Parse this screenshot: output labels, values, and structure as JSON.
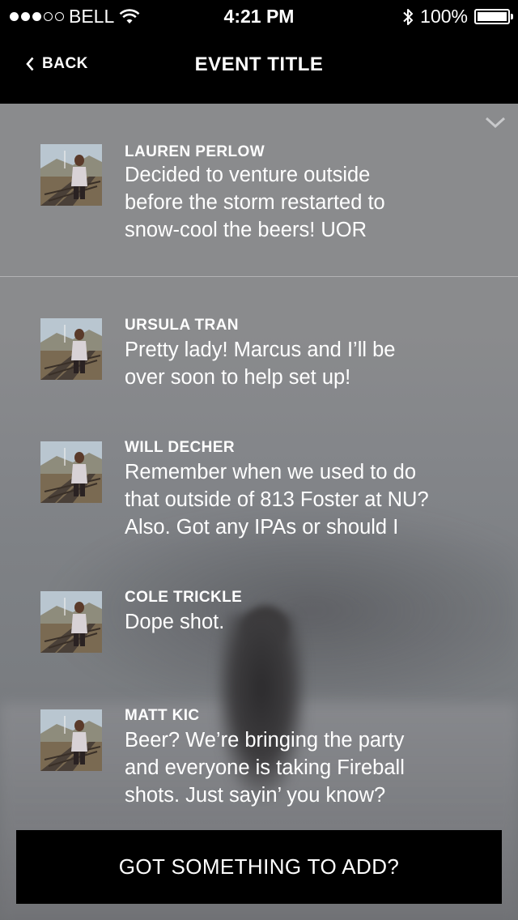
{
  "status_bar": {
    "carrier": "BELL",
    "signal_filled": 3,
    "signal_total": 5,
    "time": "4:21 PM",
    "battery_percent_label": "100%",
    "battery_level": 1.0
  },
  "nav": {
    "back_label": "BACK",
    "title": "EVENT TITLE"
  },
  "comments": [
    {
      "author": "LAUREN PERLOW",
      "line1": "Decided to venture outside",
      "line2": "before the storm restarted to",
      "line3": "snow-cool the beers! UOR"
    },
    {
      "author": "URSULA TRAN",
      "line1": "Pretty lady! Marcus and I’ll be",
      "line2": "over soon to help set up!"
    },
    {
      "author": "WILL DECHER",
      "line1": "Remember when we used to do",
      "line2": "that outside of 813 Foster at NU?",
      "line3": "Also. Got any IPAs or should I"
    },
    {
      "author": "COLE TRICKLE",
      "line1": "Dope shot."
    },
    {
      "author": "MATT KIC",
      "line1": "Beer? We’re bringing the party",
      "line2": "and everyone is taking Fireball",
      "line3": "shots. Just sayin’ you know?"
    }
  ],
  "add_button_label": "GOT SOMETHING TO ADD?",
  "icons": {
    "back": "chevron-left-icon",
    "collapse": "chevron-down-icon",
    "wifi": "wifi-icon",
    "bluetooth": "bluetooth-icon",
    "battery": "battery-icon"
  },
  "colors": {
    "bars": "#000000",
    "text": "#ffffff",
    "feed_background": "#8a8b8d"
  }
}
